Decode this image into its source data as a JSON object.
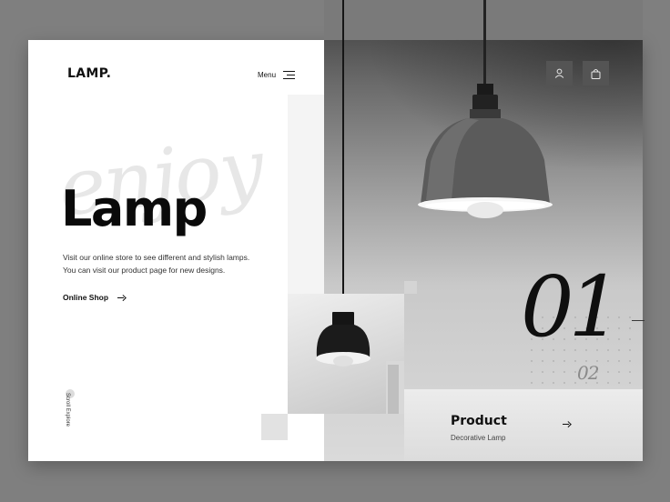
{
  "brand": {
    "logo": "LAMP."
  },
  "nav": {
    "menu_label": "Menu"
  },
  "hero": {
    "script_word": "enjoy",
    "headline": "Lamp",
    "description_line1": "Visit our online store to see different and stylish lamps.",
    "description_line2": "You can visit our product page for new designs.",
    "cta_label": "Online Shop",
    "scroll_label": "Scroll Explore"
  },
  "slider": {
    "current": "01",
    "next": "02"
  },
  "product": {
    "title": "Product",
    "subtitle": "Decorative Lamp"
  },
  "icons": {
    "user": "user-icon",
    "bag": "shopping-bag-icon",
    "menu": "hamburger-menu-icon",
    "arrow": "arrow-right-icon"
  },
  "colors": {
    "background": "#7f7f7f",
    "panel": "#ffffff",
    "text": "#111111",
    "icon_button": "#545454"
  }
}
